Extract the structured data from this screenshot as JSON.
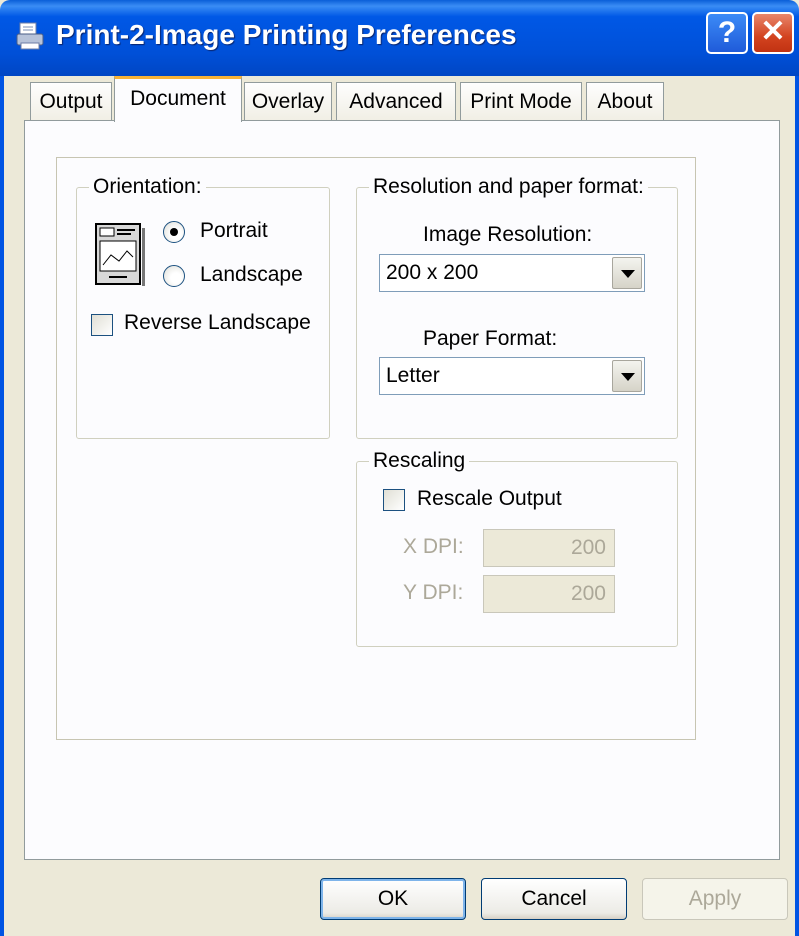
{
  "window": {
    "title": "Print-2-Image Printing Preferences",
    "help_label": "?",
    "close_label": "✕"
  },
  "tabs": [
    {
      "label": "Output",
      "active": false
    },
    {
      "label": "Document",
      "active": true
    },
    {
      "label": "Overlay",
      "active": false
    },
    {
      "label": "Advanced",
      "active": false
    },
    {
      "label": "Print Mode",
      "active": false
    },
    {
      "label": "About",
      "active": false
    }
  ],
  "orientation": {
    "legend": "Orientation:",
    "portrait_label": "Portrait",
    "landscape_label": "Landscape",
    "selected": "Portrait",
    "reverse_label": "Reverse Landscape",
    "reverse_checked": false
  },
  "resolution": {
    "legend": "Resolution and paper format:",
    "image_resolution_label": "Image Resolution:",
    "image_resolution_value": "200 x 200",
    "paper_format_label": "Paper Format:",
    "paper_format_value": "Letter"
  },
  "rescaling": {
    "legend": "Rescaling",
    "rescale_label": "Rescale Output",
    "rescale_checked": false,
    "x_dpi_label": "X DPI:",
    "x_dpi_value": "200",
    "y_dpi_label": "Y DPI:",
    "y_dpi_value": "200"
  },
  "buttons": {
    "ok": "OK",
    "cancel": "Cancel",
    "apply": "Apply"
  },
  "colors": {
    "titlebar": "#0054e3",
    "active_tab_accent": "#f8b338",
    "dialog_bg": "#ece9d8"
  }
}
